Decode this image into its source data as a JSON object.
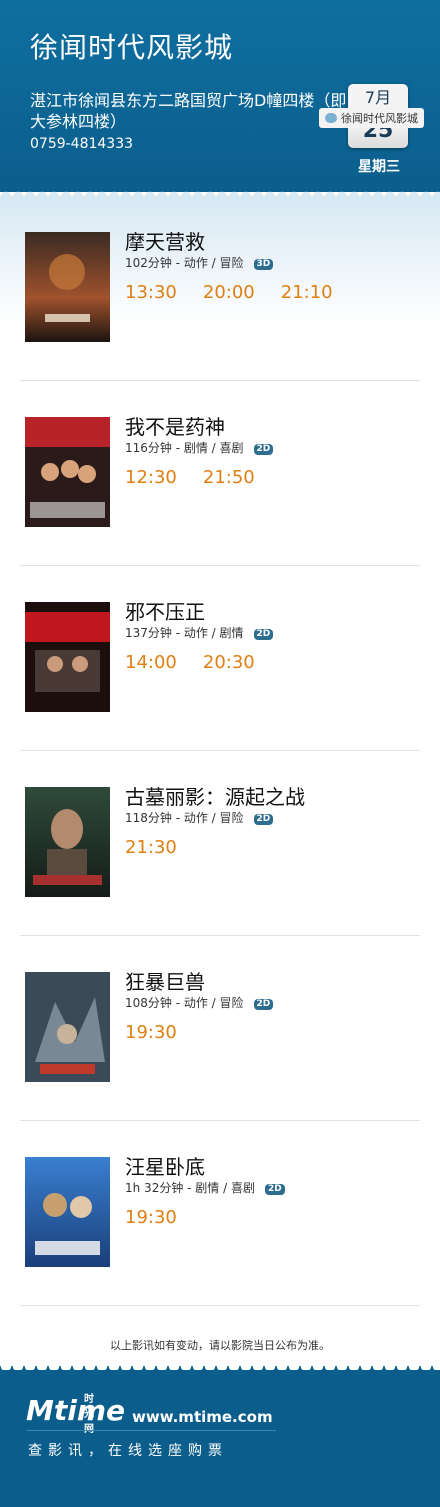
{
  "header": {
    "cinema_name": "徐闻时代风影城",
    "address": "湛江市徐闻县东方二路国贸广场D幢四楼（即大参林四楼）",
    "phone": "0759-4814333",
    "date": {
      "month": "7月",
      "day": "25",
      "weekday": "星期三"
    }
  },
  "movies": [
    {
      "title": "摩天营救",
      "meta": "102分钟 - 动作 / 冒险",
      "format": "3D",
      "times": [
        "13:30",
        "20:00",
        "21:10"
      ]
    },
    {
      "title": "我不是药神",
      "meta": "116分钟 - 剧情 / 喜剧",
      "format": "2D",
      "times": [
        "12:30",
        "21:50"
      ]
    },
    {
      "title": "邪不压正",
      "meta": "137分钟 - 动作 / 剧情",
      "format": "2D",
      "times": [
        "14:00",
        "20:30"
      ]
    },
    {
      "title": "古墓丽影：源起之战",
      "meta": "118分钟 - 动作 / 冒险",
      "format": "2D",
      "times": [
        "21:30"
      ]
    },
    {
      "title": "狂暴巨兽",
      "meta": "108分钟 - 动作 / 冒险",
      "format": "2D",
      "times": [
        "19:30"
      ]
    },
    {
      "title": "汪星卧底",
      "meta": "1h 32分钟 - 剧情 / 喜剧",
      "format": "2D",
      "times": [
        "19:30"
      ]
    }
  ],
  "notice": "以上影讯如有变动，请以影院当日公布为准。",
  "footer": {
    "logo_text": "Mtime",
    "logo_cn": "时光网",
    "site": "www.mtime.com",
    "slogan": "查影讯，在线选座购票",
    "wechat": "徐闻时代风影城"
  },
  "colors": {
    "header_bg": "#0b5e8c",
    "time_text": "#e07f12",
    "badge_bg": "#2e6d8f"
  }
}
